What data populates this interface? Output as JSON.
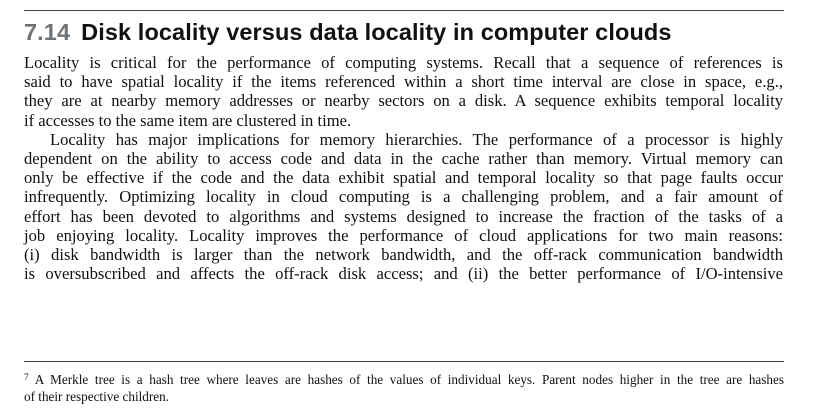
{
  "section": {
    "number": "7.14",
    "title": "Disk locality versus data locality in computer clouds"
  },
  "paragraphs": [
    {
      "lines": [
        "Locality is critical for the performance of computing systems. Recall that a sequence of references is",
        "said to have spatial locality if the items referenced within a short time interval are close in space, e.g.,",
        "they are at nearby memory addresses or nearby sectors on a disk. A sequence exhibits temporal locality",
        "if accesses to the same item are clustered in time."
      ]
    },
    {
      "lines": [
        "Locality has major implications for memory hierarchies. The performance of a processor is highly",
        "dependent on the ability to access code and data in the cache rather than memory. Virtual memory can",
        "only be effective if the code and the data exhibit spatial and temporal locality so that page faults occur",
        "infrequently. Optimizing locality in cloud computing is a challenging problem, and a fair amount of",
        "effort has been devoted to algorithms and systems designed to increase the fraction of the tasks of a",
        "job enjoying locality. Locality improves the performance of cloud applications for two main reasons:",
        "(i) disk bandwidth is larger than the network bandwidth, and the off-rack communication bandwidth",
        "is oversubscribed and affects the off-rack disk access; and (ii) the better performance of I/O-intensive"
      ]
    }
  ],
  "footnote": {
    "marker": "7",
    "lines": [
      "A Merkle tree is a hash tree where leaves are hashes of the values of individual keys. Parent nodes higher in the tree are hashes",
      "of their respective children."
    ]
  }
}
